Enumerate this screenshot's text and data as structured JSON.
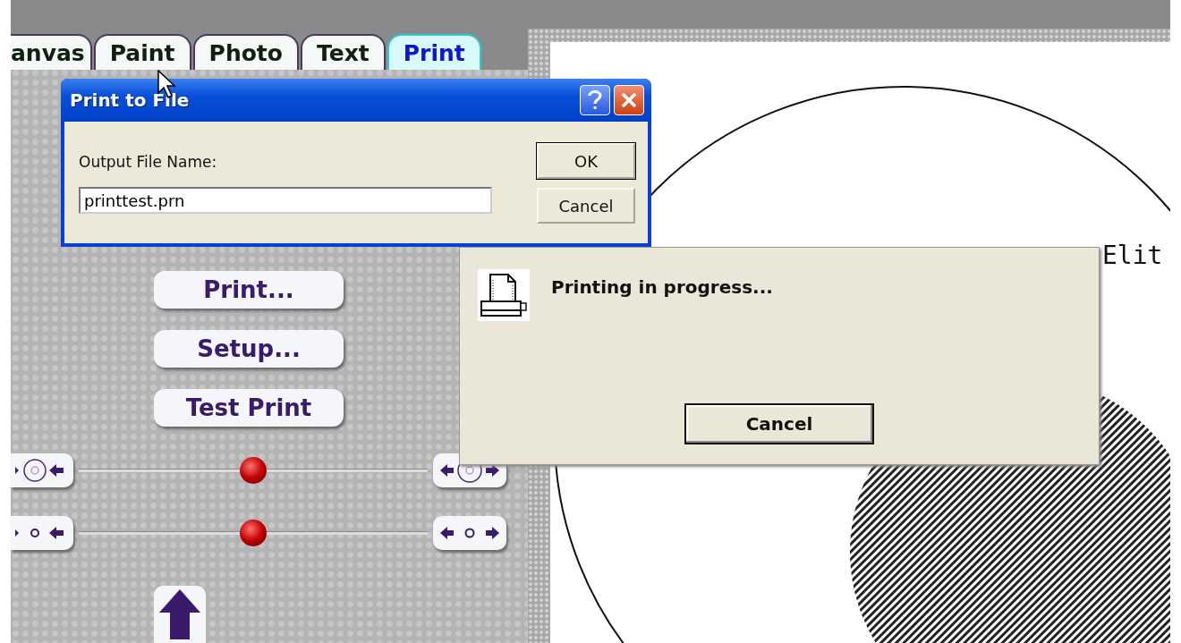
{
  "tabs": [
    {
      "label": "anvas",
      "selected": false
    },
    {
      "label": "Paint",
      "selected": false
    },
    {
      "label": "Photo",
      "selected": false
    },
    {
      "label": "Text",
      "selected": false
    },
    {
      "label": "Print",
      "selected": true
    }
  ],
  "panel_buttons": [
    "Print...",
    "Setup...",
    "Test Print"
  ],
  "sliders": [
    {
      "kind": "size",
      "level": 0.5
    },
    {
      "kind": "dot",
      "level": 0.5
    }
  ],
  "canvas": {
    "text": "Elit"
  },
  "print_to_file_dialog": {
    "title": "Print to File",
    "field_label": "Output File Name:",
    "value": "printtest.prn",
    "buttons": [
      "OK",
      "Cancel"
    ]
  },
  "progress_dialog": {
    "message": "Printing in progress...",
    "button": "Cancel"
  }
}
